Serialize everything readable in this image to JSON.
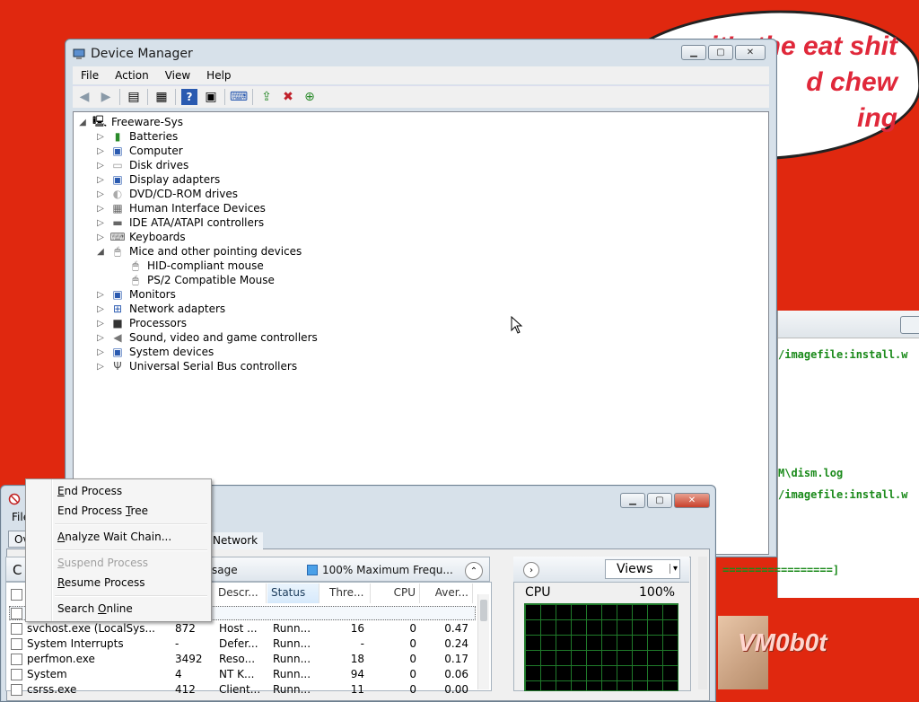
{
  "wallpaper": {
    "bubble_lines": [
      "it's the eat shit",
      "d chew",
      "ing"
    ],
    "watermark": "VM0b0t"
  },
  "console": {
    "lines": [
      "/imagefile:install.w",
      "M\\dism.log",
      "/imagefile:install.w",
      "=================]"
    ]
  },
  "device_manager": {
    "title": "Device Manager",
    "menu": [
      "File",
      "Action",
      "View",
      "Help"
    ],
    "toolbar_icons": [
      "back-arrow-icon",
      "forward-arrow-icon",
      "show-hide-console-tree-icon",
      "properties-icon",
      "help-icon",
      "action-pane-icon",
      "scan-hardware-icon",
      "update-driver-icon",
      "uninstall-icon",
      "enable-device-icon"
    ],
    "root": "Freeware-Sys",
    "categories": [
      {
        "label": "Batteries",
        "icon": "battery-icon",
        "expanded": false
      },
      {
        "label": "Computer",
        "icon": "computer-icon",
        "expanded": false
      },
      {
        "label": "Disk drives",
        "icon": "disk-drive-icon",
        "expanded": false
      },
      {
        "label": "Display adapters",
        "icon": "display-adapter-icon",
        "expanded": false
      },
      {
        "label": "DVD/CD-ROM drives",
        "icon": "dvd-drive-icon",
        "expanded": false
      },
      {
        "label": "Human Interface Devices",
        "icon": "hid-icon",
        "expanded": false
      },
      {
        "label": "IDE ATA/ATAPI controllers",
        "icon": "ide-controller-icon",
        "expanded": false
      },
      {
        "label": "Keyboards",
        "icon": "keyboard-icon",
        "expanded": false
      },
      {
        "label": "Mice and other pointing devices",
        "icon": "mouse-icon",
        "expanded": true,
        "children": [
          "HID-compliant mouse",
          "PS/2 Compatible Mouse"
        ]
      },
      {
        "label": "Monitors",
        "icon": "monitor-icon",
        "expanded": false
      },
      {
        "label": "Network adapters",
        "icon": "network-adapter-icon",
        "expanded": false
      },
      {
        "label": "Processors",
        "icon": "processor-icon",
        "expanded": false
      },
      {
        "label": "Sound, video and game controllers",
        "icon": "sound-icon",
        "expanded": false
      },
      {
        "label": "System devices",
        "icon": "system-devices-icon",
        "expanded": false
      },
      {
        "label": "Universal Serial Bus controllers",
        "icon": "usb-icon",
        "expanded": false
      }
    ]
  },
  "task_manager": {
    "menu_file": "File",
    "tab_overview": "Ov",
    "tab_network": "Network",
    "cpu_header_fragment": "C",
    "usage_fragment": "sage",
    "max_frequency": "100% Maximum Frequ...",
    "columns": [
      "",
      "Descr...",
      "Status",
      "Thre...",
      "CPU",
      "Aver..."
    ],
    "rows": [
      {
        "name": "svchost.exe (LocalSys...",
        "pid": "872",
        "desc": "Host ...",
        "status": "Runn...",
        "threads": "16",
        "cpu": "0",
        "avg": "0.47"
      },
      {
        "name": "System Interrupts",
        "pid": "-",
        "desc": "Defer...",
        "status": "Runn...",
        "threads": "-",
        "cpu": "0",
        "avg": "0.24"
      },
      {
        "name": "perfmon.exe",
        "pid": "3492",
        "desc": "Reso...",
        "status": "Runn...",
        "threads": "18",
        "cpu": "0",
        "avg": "0.17"
      },
      {
        "name": "System",
        "pid": "4",
        "desc": "NT K...",
        "status": "Runn...",
        "threads": "94",
        "cpu": "0",
        "avg": "0.06"
      },
      {
        "name": "csrss.exe",
        "pid": "412",
        "desc": "Client...",
        "status": "Runn...",
        "threads": "11",
        "cpu": "0",
        "avg": "0.00"
      }
    ],
    "views_label": "Views",
    "cpu_label": "CPU",
    "cpu_percent": "100%"
  },
  "context_menu": {
    "items": [
      {
        "label": "End Process",
        "accel": "E",
        "enabled": true
      },
      {
        "label": "End Process Tree",
        "accel": "T",
        "enabled": true
      },
      {
        "label": "Analyze Wait Chain...",
        "accel": "A",
        "enabled": true
      },
      {
        "label": "Suspend Process",
        "accel": "S",
        "enabled": false
      },
      {
        "label": "Resume Process",
        "accel": "R",
        "enabled": true
      },
      {
        "label": "Search Online",
        "accel": "O",
        "enabled": true
      }
    ]
  },
  "colors": {
    "desktop": "#e0280f",
    "console_text": "#1a8a1a",
    "cpu_grid": "#1f7a2a",
    "close_button": "#c8402a"
  }
}
